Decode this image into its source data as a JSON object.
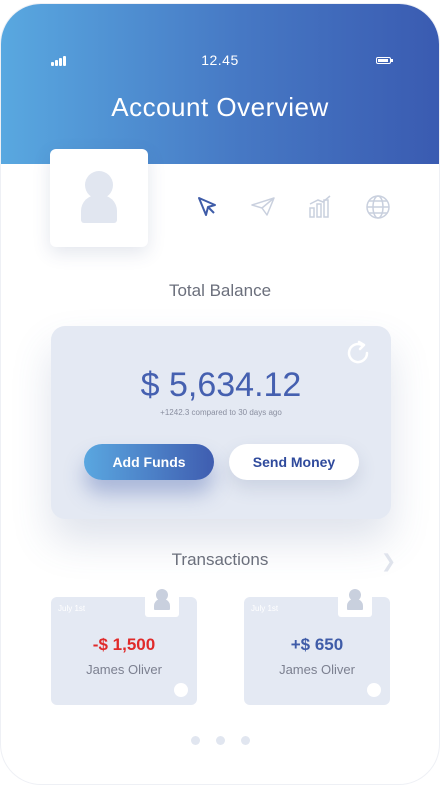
{
  "status_bar": {
    "time": "12.45",
    "signal_icon": "signal-icon",
    "battery_icon": "battery-icon"
  },
  "header": {
    "title": "Account Overview"
  },
  "profile": {
    "avatar_icon": "user-avatar-icon"
  },
  "actions": [
    {
      "icon": "cursor-icon",
      "active": true
    },
    {
      "icon": "paper-plane-icon",
      "active": false
    },
    {
      "icon": "bar-chart-icon",
      "active": false
    },
    {
      "icon": "globe-icon",
      "active": false
    }
  ],
  "balance": {
    "section_label": "Total Balance",
    "amount": "$ 5,634.12",
    "change_note": "+1242.3 compared to 30 days ago",
    "refresh_icon": "refresh-icon",
    "add_funds_label": "Add Funds",
    "send_money_label": "Send Money"
  },
  "transactions": {
    "section_label": "Transactions",
    "arrow_icon": "chevron-right-icon",
    "items": [
      {
        "date": "July 1st",
        "amount": "-$ 1,500",
        "name": "James Oliver",
        "amount_color": "#e02a2a"
      },
      {
        "date": "July 1st",
        "amount": "+$ 650",
        "name": "James Oliver",
        "amount_color": "#3f5ca8"
      }
    ]
  },
  "pagination": {
    "pages": 3
  },
  "colors": {
    "header_gradient_start": "#59a8e0",
    "header_gradient_end": "#3a5bb1",
    "accent": "#4560b0",
    "card_bg": "#e4e9f3",
    "negative": "#e02a2a"
  }
}
